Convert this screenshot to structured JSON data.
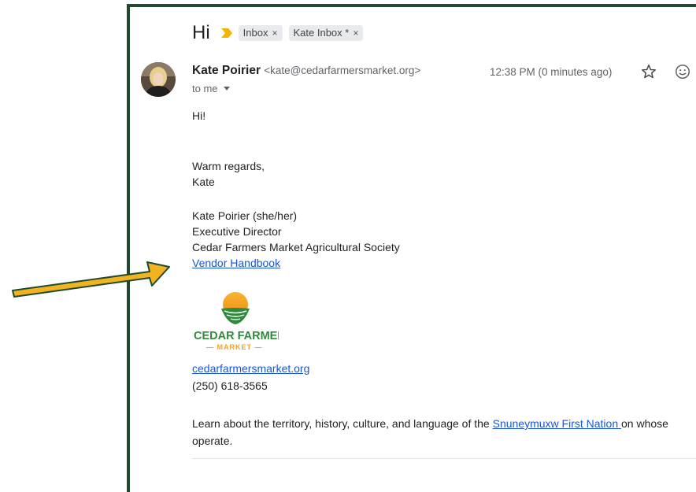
{
  "subject": "Hi",
  "labels": [
    {
      "text": "Inbox",
      "close": "×"
    },
    {
      "text": "Kate Inbox *",
      "close": "×"
    }
  ],
  "sender": {
    "name": "Kate Poirier",
    "email": "<kate@cedarfarmersmarket.org>"
  },
  "recipient": "to me",
  "timestamp": "12:38 PM (0 minutes ago)",
  "body": {
    "greeting": "Hi!",
    "closing": "Warm regards,",
    "signoff": "Kate"
  },
  "signature": {
    "name_line": "Kate Poirier (she/her)",
    "title": "Executive Director",
    "org": "Cedar Farmers Market Agricultural Society",
    "handbook_link": "Vendor Handbook",
    "logo_main": "CEDAR FARMERS",
    "logo_sub": "— MARKET —",
    "website": "cedarfarmersmarket.org",
    "phone": "(250) 618-3565"
  },
  "territory": {
    "prefix": "Learn about the territory, history, culture, and language of the ",
    "link": "Snuneymuxw First Nation ",
    "suffix": "on whose",
    "line2": "operate."
  },
  "colors": {
    "frame": "#1f4a2c",
    "arrow_fill": "#f2b320",
    "arrow_stroke": "#1f4a2c",
    "link": "#1a55d6",
    "logo_green": "#2f8a3b",
    "logo_orange": "#f4a12a"
  },
  "icons": [
    "importance-marker-icon",
    "star-icon",
    "emoji-reaction-icon",
    "dropdown-caret-icon",
    "annotation-arrow"
  ]
}
